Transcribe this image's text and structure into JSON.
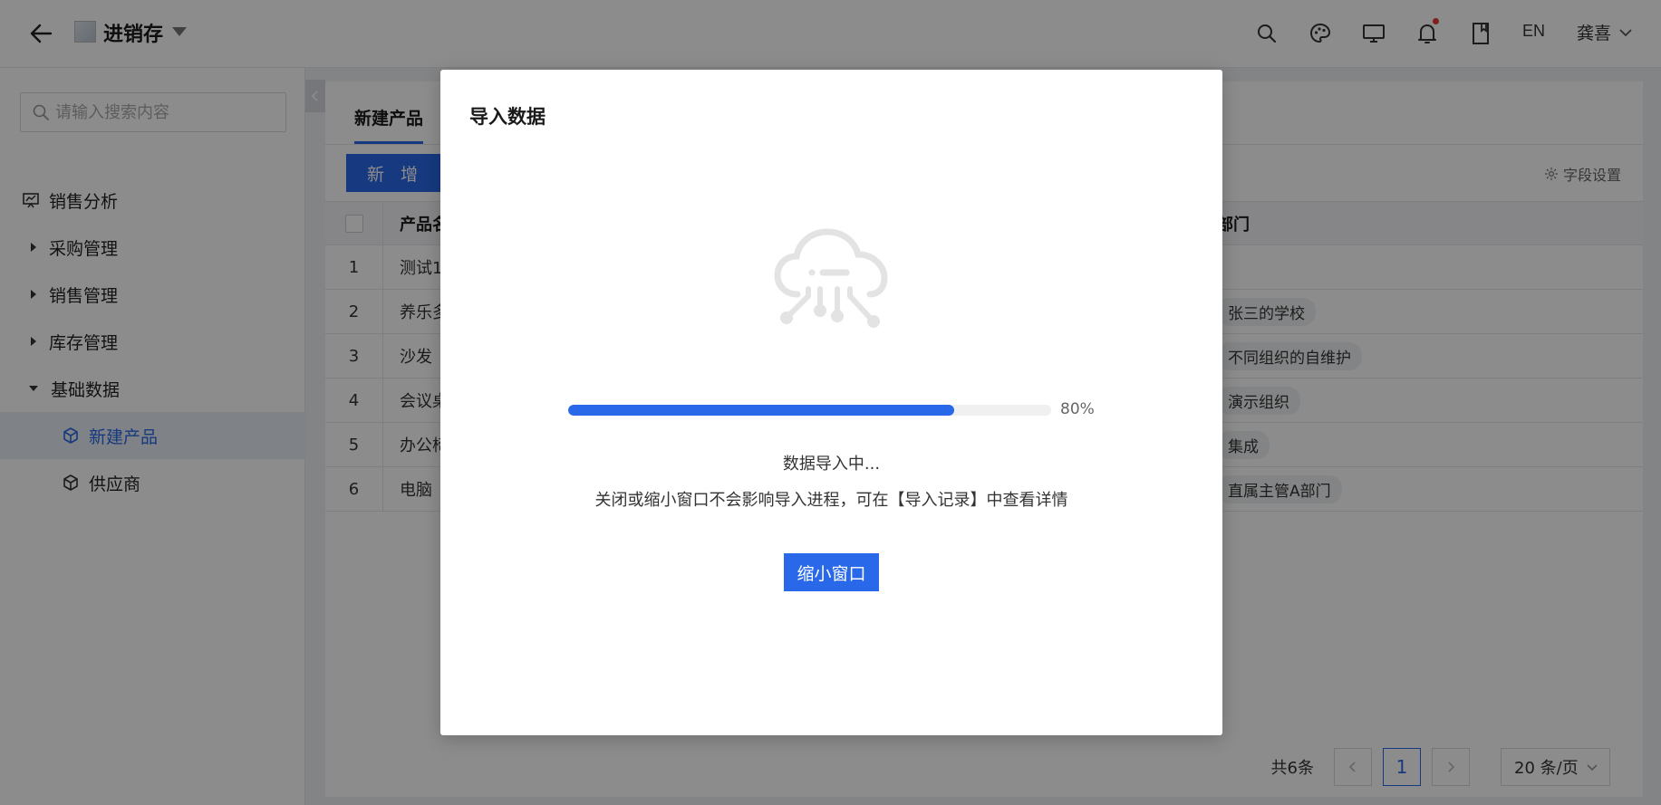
{
  "header": {
    "app_title": "进销存",
    "lang_label": "EN",
    "user_name": "龚喜"
  },
  "sidebar": {
    "search_placeholder": "请输入搜索内容",
    "items": [
      {
        "label": "销售分析"
      },
      {
        "label": "采购管理"
      },
      {
        "label": "销售管理"
      },
      {
        "label": "库存管理"
      },
      {
        "label": "基础数据"
      },
      {
        "label": "新建产品"
      },
      {
        "label": "供应商"
      }
    ]
  },
  "main": {
    "tab_label": "新建产品",
    "add_button": "新 增",
    "field_settings": "字段设置",
    "table": {
      "columns": {
        "name": "产品名",
        "dept": "部门"
      },
      "rows": [
        {
          "idx": "1",
          "name": "测试1",
          "dept": ""
        },
        {
          "idx": "2",
          "name": "养乐多",
          "dept": "张三的学校"
        },
        {
          "idx": "3",
          "name": "沙发",
          "dept": "不同组织的自维护"
        },
        {
          "idx": "4",
          "name": "会议桌",
          "dept": "演示组织"
        },
        {
          "idx": "5",
          "name": "办公椅",
          "dept": "集成"
        },
        {
          "idx": "6",
          "name": "电脑",
          "dept": "直属主管A部门"
        }
      ]
    },
    "pager": {
      "total": "共6条",
      "current_page": "1",
      "page_size": "20 条/页"
    }
  },
  "modal": {
    "title": "导入数据",
    "progress_percent": 80,
    "progress_label": "80%",
    "status_line1": "数据导入中...",
    "status_line2": "关闭或缩小窗口不会影响导入进程，可在【导入记录】中查看详情",
    "minimize_button": "缩小窗口"
  },
  "colors": {
    "accent": "#2968e8",
    "notify_dot": "#e53935"
  }
}
